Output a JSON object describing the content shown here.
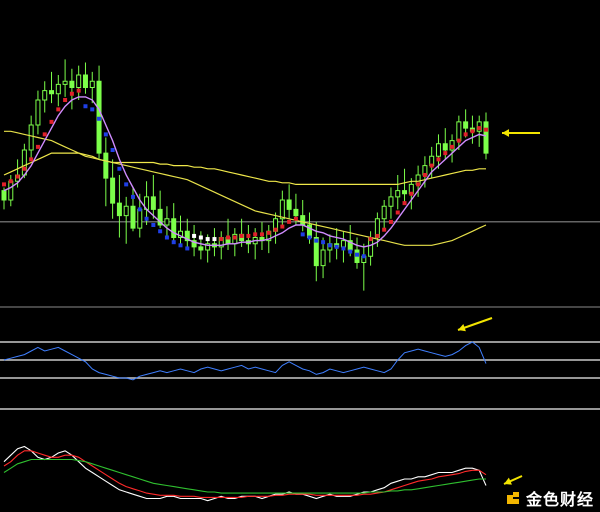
{
  "app": {
    "watermark_text": "金色财经"
  },
  "colors": {
    "background": "#000000",
    "candle_bull": "#7cff4a",
    "candle_bear": "#7cff4a",
    "ma_fast": "#d08cff",
    "ma_yellow_1": "#e6e04a",
    "ma_yellow_2": "#f0e84a",
    "dots_up": "#e0202a",
    "dots_down": "#1f3fe6",
    "dots_neutral": "#ffffff",
    "hline": "#c9c9c9",
    "rsi_line": "#3f7fff",
    "macd_white": "#ffffff",
    "macd_red": "#ff2a2a",
    "macd_green": "#2fbf2f",
    "arrow": "#f2e400"
  },
  "chart_data": [
    {
      "type": "candlestick",
      "title": "",
      "candles": [
        [
          130,
          132,
          118,
          124
        ],
        [
          124,
          140,
          120,
          136
        ],
        [
          136,
          150,
          132,
          140
        ],
        [
          140,
          160,
          138,
          156
        ],
        [
          156,
          178,
          150,
          172
        ],
        [
          172,
          194,
          166,
          188
        ],
        [
          188,
          200,
          180,
          194
        ],
        [
          194,
          206,
          186,
          192
        ],
        [
          192,
          204,
          184,
          198
        ],
        [
          198,
          214,
          190,
          200
        ],
        [
          200,
          208,
          182,
          196
        ],
        [
          196,
          210,
          188,
          204
        ],
        [
          204,
          212,
          192,
          196
        ],
        [
          196,
          206,
          186,
          200
        ],
        [
          200,
          210,
          150,
          154
        ],
        [
          154,
          164,
          120,
          138
        ],
        [
          138,
          150,
          112,
          122
        ],
        [
          122,
          140,
          100,
          114
        ],
        [
          114,
          126,
          96,
          120
        ],
        [
          120,
          132,
          104,
          106
        ],
        [
          106,
          128,
          100,
          118
        ],
        [
          118,
          136,
          108,
          126
        ],
        [
          126,
          140,
          112,
          118
        ],
        [
          118,
          130,
          106,
          108
        ],
        [
          108,
          120,
          100,
          112
        ],
        [
          112,
          122,
          96,
          100
        ],
        [
          100,
          114,
          94,
          104
        ],
        [
          104,
          112,
          92,
          98
        ],
        [
          98,
          108,
          88,
          94
        ],
        [
          94,
          104,
          86,
          92
        ],
        [
          92,
          102,
          84,
          96
        ],
        [
          96,
          106,
          88,
          94
        ],
        [
          94,
          104,
          86,
          100
        ],
        [
          100,
          112,
          92,
          96
        ],
        [
          96,
          106,
          88,
          102
        ],
        [
          102,
          112,
          94,
          98
        ],
        [
          98,
          108,
          90,
          96
        ],
        [
          96,
          106,
          86,
          100
        ],
        [
          100,
          110,
          92,
          98
        ],
        [
          98,
          108,
          90,
          104
        ],
        [
          104,
          116,
          96,
          112
        ],
        [
          112,
          130,
          106,
          124
        ],
        [
          124,
          134,
          112,
          118
        ],
        [
          118,
          128,
          108,
          114
        ],
        [
          114,
          124,
          104,
          108
        ],
        [
          108,
          116,
          96,
          100
        ],
        [
          100,
          110,
          72,
          82
        ],
        [
          82,
          100,
          74,
          92
        ],
        [
          92,
          102,
          84,
          96
        ],
        [
          96,
          106,
          86,
          94
        ],
        [
          94,
          104,
          84,
          98
        ],
        [
          98,
          108,
          88,
          92
        ],
        [
          92,
          100,
          80,
          84
        ],
        [
          84,
          96,
          66,
          88
        ],
        [
          88,
          104,
          82,
          100
        ],
        [
          100,
          116,
          94,
          112
        ],
        [
          112,
          124,
          104,
          120
        ],
        [
          120,
          132,
          112,
          126
        ],
        [
          126,
          140,
          118,
          130
        ],
        [
          130,
          144,
          122,
          128
        ],
        [
          128,
          138,
          118,
          134
        ],
        [
          134,
          146,
          126,
          140
        ],
        [
          140,
          152,
          132,
          146
        ],
        [
          146,
          158,
          138,
          152
        ],
        [
          152,
          166,
          144,
          160
        ],
        [
          160,
          170,
          150,
          156
        ],
        [
          156,
          166,
          148,
          162
        ],
        [
          162,
          178,
          156,
          174
        ],
        [
          174,
          182,
          164,
          170
        ],
        [
          170,
          178,
          160,
          168
        ],
        [
          168,
          178,
          158,
          174
        ],
        [
          174,
          180,
          150,
          154
        ]
      ],
      "ma_fast": [
        130,
        132,
        135,
        140,
        146,
        154,
        162,
        170,
        178,
        184,
        188,
        190,
        190,
        188,
        182,
        172,
        162,
        150,
        140,
        132,
        124,
        118,
        114,
        110,
        106,
        103,
        101,
        99,
        97,
        96,
        95,
        95,
        95,
        96,
        96,
        97,
        97,
        98,
        98,
        99,
        101,
        103,
        106,
        108,
        108,
        106,
        104,
        103,
        101,
        100,
        99,
        97,
        95,
        94,
        95,
        97,
        101,
        106,
        112,
        118,
        124,
        130,
        136,
        142,
        146,
        150,
        154,
        158,
        162,
        164,
        166,
        165
      ],
      "ma_yellow_1": [
        168,
        168,
        167,
        166,
        165,
        164,
        163,
        162,
        160,
        158,
        156,
        154,
        152,
        151,
        150,
        149,
        148,
        147,
        146,
        145,
        144,
        143,
        142,
        141,
        140,
        139,
        138,
        137,
        135,
        133,
        131,
        129,
        127,
        125,
        123,
        121,
        119,
        117,
        116,
        115,
        114,
        113,
        112,
        111,
        110,
        109,
        108,
        107,
        106,
        105,
        104,
        103,
        102,
        101,
        100,
        99,
        98,
        97,
        96,
        95,
        95,
        95,
        95,
        95,
        96,
        97,
        98,
        100,
        102,
        104,
        106,
        108
      ],
      "ma_yellow_2": [
        140,
        142,
        144,
        146,
        148,
        150,
        152,
        154,
        154,
        154,
        154,
        154,
        153,
        152,
        150,
        149,
        148,
        148,
        148,
        148,
        148,
        148,
        148,
        147,
        147,
        146,
        146,
        146,
        145,
        145,
        144,
        144,
        143,
        142,
        141,
        140,
        139,
        138,
        137,
        136,
        136,
        135,
        135,
        134,
        134,
        134,
        134,
        134,
        134,
        134,
        134,
        134,
        134,
        134,
        134,
        134,
        134,
        134,
        134,
        135,
        136,
        136,
        137,
        138,
        139,
        140,
        141,
        142,
        143,
        143,
        144,
        144
      ],
      "signal_dots": "dddddddddddddddddddddddddddd",
      "dot_pattern": [
        "up",
        "up",
        "up",
        "up",
        "up",
        "up",
        "up",
        "up",
        "up",
        "up",
        "up",
        "up",
        "down",
        "down",
        "down",
        "down",
        "down",
        "down",
        "down",
        "down",
        "down",
        "down",
        "down",
        "down",
        "down",
        "down",
        "down",
        "down",
        "neutral",
        "neutral",
        "neutral",
        "neutral",
        "up",
        "up",
        "up",
        "up",
        "up",
        "up",
        "up",
        "up",
        "up",
        "up",
        "up",
        "up",
        "down",
        "down",
        "down",
        "down",
        "down",
        "down",
        "down",
        "down",
        "down",
        "down",
        "up",
        "up",
        "up",
        "up",
        "up",
        "up",
        "up",
        "up",
        "up",
        "up",
        "up",
        "up",
        "up",
        "up",
        "up",
        "up",
        "up",
        "up"
      ],
      "hline_value": 110
    },
    {
      "type": "line",
      "title": "",
      "series": [
        {
          "values": [
            50,
            52,
            54,
            56,
            60,
            64,
            60,
            62,
            64,
            60,
            56,
            52,
            48,
            40,
            36,
            34,
            32,
            30,
            30,
            28,
            32,
            34,
            36,
            38,
            36,
            38,
            40,
            38,
            36,
            40,
            42,
            40,
            38,
            40,
            42,
            44,
            40,
            42,
            40,
            38,
            36,
            44,
            48,
            44,
            40,
            38,
            34,
            36,
            40,
            38,
            36,
            38,
            40,
            42,
            40,
            38,
            36,
            40,
            50,
            58,
            60,
            62,
            60,
            58,
            56,
            54,
            56,
            60,
            66,
            70,
            64,
            46
          ]
        }
      ],
      "ylim": [
        0,
        100
      ],
      "levels": [
        70,
        50,
        30
      ]
    },
    {
      "type": "line",
      "title": "",
      "series": [
        {
          "values": [
            40,
            46,
            52,
            54,
            50,
            44,
            42,
            44,
            48,
            50,
            46,
            40,
            34,
            30,
            26,
            22,
            18,
            14,
            12,
            10,
            8,
            6,
            6,
            6,
            8,
            8,
            6,
            6,
            6,
            6,
            4,
            6,
            8,
            6,
            6,
            8,
            8,
            8,
            6,
            8,
            10,
            10,
            12,
            10,
            10,
            8,
            6,
            8,
            10,
            8,
            8,
            8,
            10,
            12,
            12,
            14,
            16,
            20,
            22,
            24,
            24,
            26,
            26,
            28,
            30,
            30,
            30,
            32,
            34,
            34,
            32,
            18
          ]
        },
        {
          "values": [
            36,
            40,
            46,
            50,
            50,
            48,
            46,
            44,
            44,
            46,
            46,
            44,
            40,
            36,
            32,
            28,
            24,
            20,
            17,
            15,
            13,
            11,
            10,
            9,
            9,
            9,
            8,
            8,
            8,
            7,
            7,
            7,
            7,
            7,
            7,
            7,
            8,
            8,
            8,
            8,
            9,
            9,
            10,
            10,
            10,
            10,
            9,
            9,
            9,
            9,
            9,
            9,
            9,
            10,
            10,
            11,
            12,
            14,
            16,
            18,
            20,
            22,
            23,
            24,
            26,
            27,
            28,
            29,
            31,
            32,
            32,
            28
          ]
        },
        {
          "values": [
            30,
            34,
            38,
            40,
            42,
            42,
            42,
            42,
            42,
            42,
            42,
            41,
            40,
            38,
            36,
            34,
            32,
            30,
            28,
            26,
            24,
            22,
            20,
            19,
            18,
            17,
            16,
            15,
            14,
            13,
            12,
            12,
            11,
            11,
            11,
            11,
            11,
            11,
            11,
            11,
            11,
            11,
            11,
            11,
            11,
            11,
            11,
            11,
            11,
            11,
            11,
            11,
            11,
            11,
            12,
            12,
            12,
            13,
            13,
            14,
            14,
            15,
            16,
            17,
            18,
            19,
            20,
            21,
            22,
            23,
            24,
            24
          ]
        }
      ],
      "ylim": [
        0,
        60
      ]
    }
  ]
}
